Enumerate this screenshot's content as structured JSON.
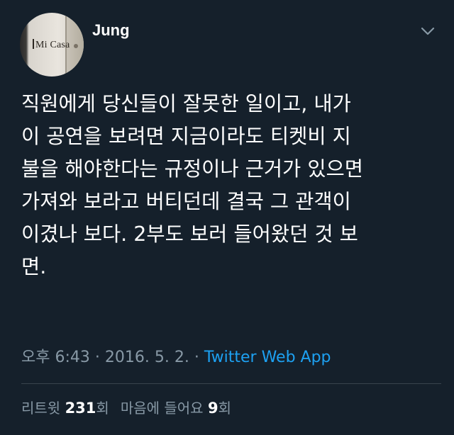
{
  "user": {
    "name": "Jung",
    "avatar_text": "Mi Casa"
  },
  "icons": {
    "menu": "chevron-down-icon"
  },
  "tweet": {
    "lines": [
      "직원에게 당신들이 잘못한 일이고, 내가",
      "이 공연을 보려면 지금이라도 티켓비 지",
      "불을 해야한다는 규정이나 근거가 있으면",
      "가져와 보라고 버티던데 결국 그 관객이",
      "이겼나 보다. 2부도 보러 들어왔던 것 보",
      "면."
    ]
  },
  "meta": {
    "time": "오후 6:43",
    "date": "2016. 5. 2.",
    "separator": "·",
    "source": "Twitter Web App"
  },
  "stats": {
    "retweet_label": "리트윗",
    "retweet_count": "231",
    "retweet_unit": "회",
    "like_label": "마음에 들어요",
    "like_count": "9",
    "like_unit": "회"
  },
  "colors": {
    "background": "#15202b",
    "text": "#ffffff",
    "muted": "#8899a6",
    "accent": "#1da1f2",
    "divider": "#38444d"
  }
}
